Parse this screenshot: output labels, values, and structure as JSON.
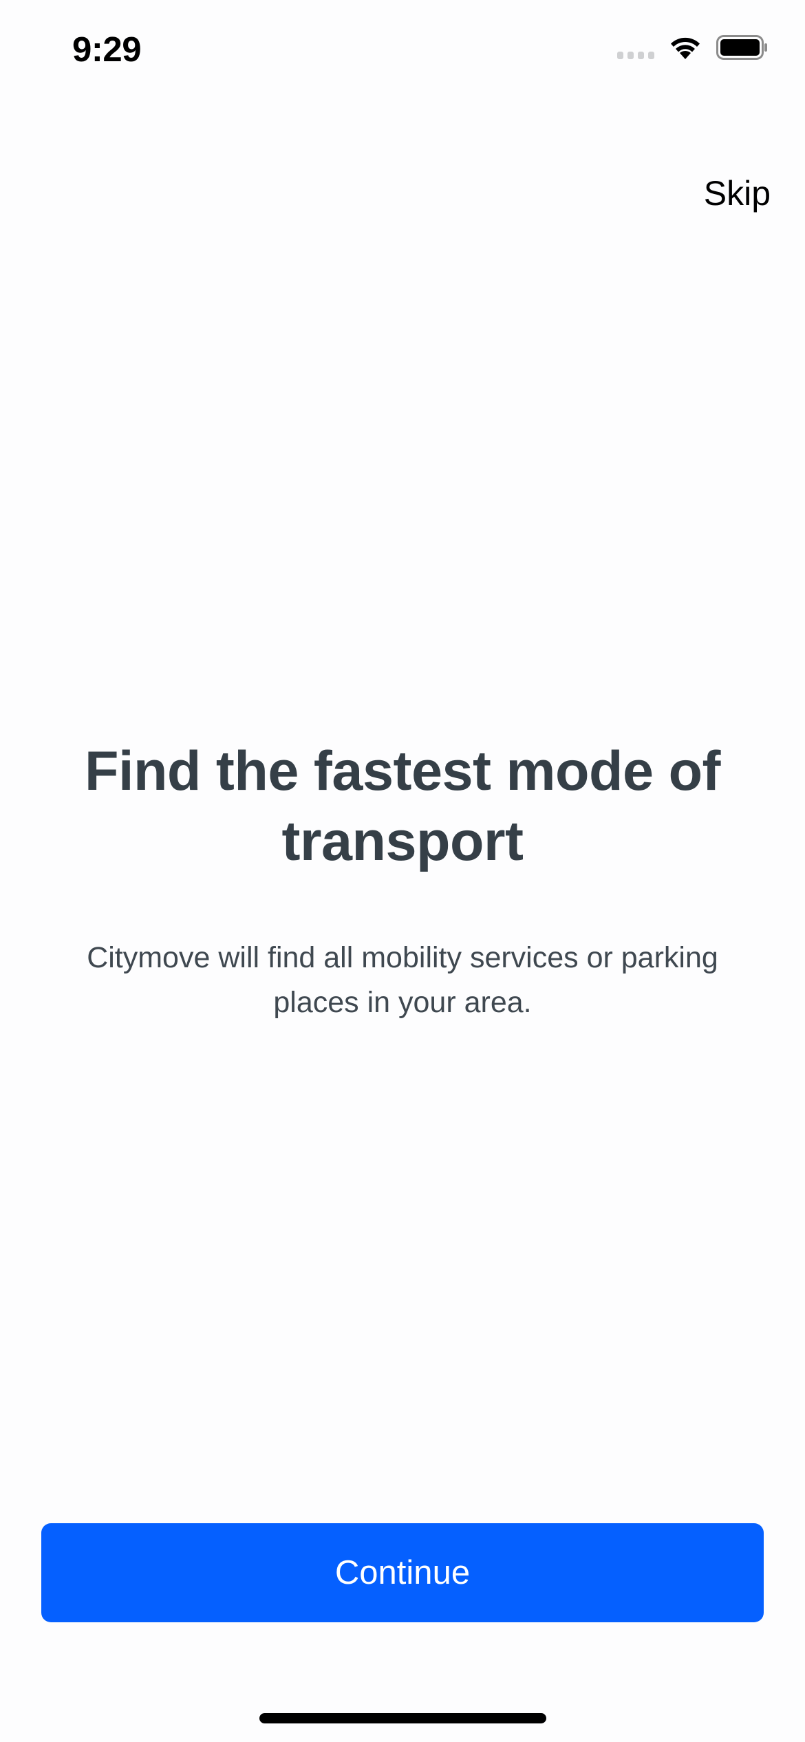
{
  "status_bar": {
    "time": "9:29",
    "icons": [
      "cellular-signal-icon",
      "wifi-icon",
      "battery-icon"
    ]
  },
  "header": {
    "skip_label": "Skip"
  },
  "onboarding": {
    "title": "Find the fastest mode of transport",
    "description": "Citymove will find all mobility services or parking places in your area."
  },
  "footer": {
    "continue_label": "Continue"
  },
  "colors": {
    "accent": "#0560ff",
    "text_primary": "#353f47",
    "background": "#fdfdfe"
  }
}
